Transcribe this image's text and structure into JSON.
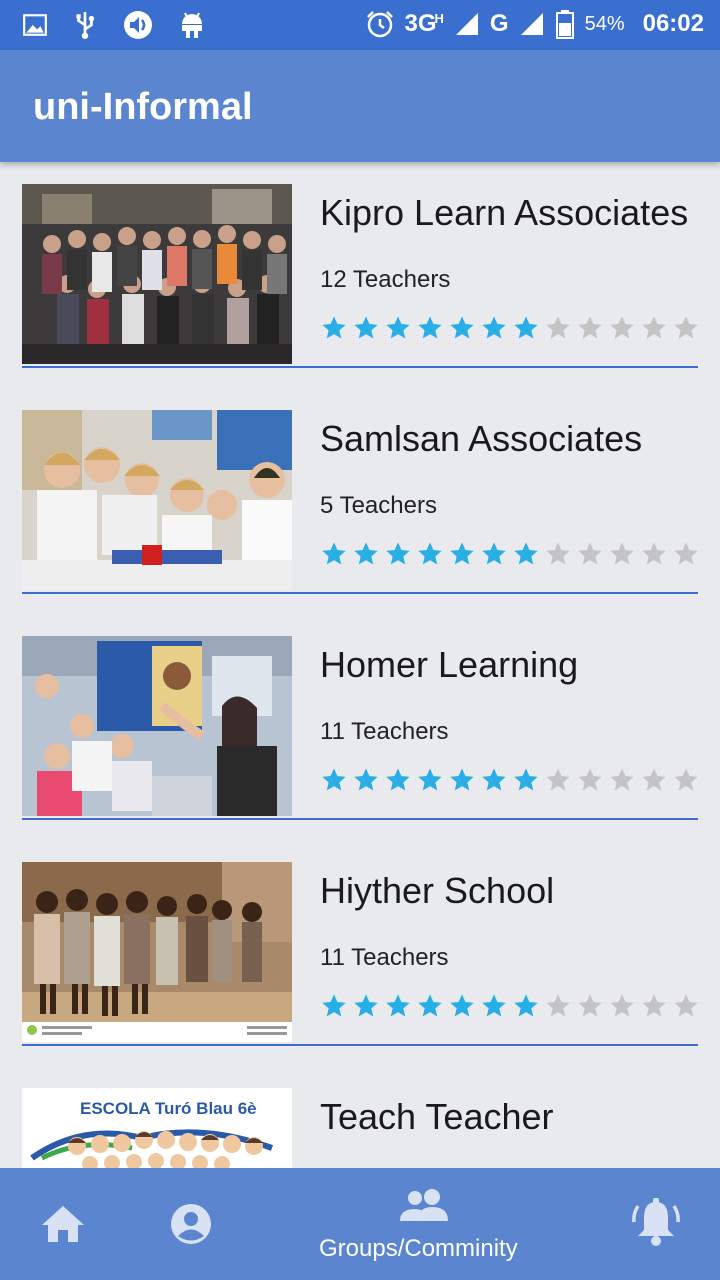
{
  "status_bar": {
    "network_3g": "3G",
    "network_h": "H",
    "network_g": "G",
    "battery": "54%",
    "time": "06:02"
  },
  "app_bar": {
    "title": "uni-Informal"
  },
  "groups": [
    {
      "name": "Kipro Learn Associates",
      "teachers": "12 Teachers",
      "rating": 7,
      "max_rating": 12
    },
    {
      "name": "Samlsan Associates",
      "teachers": "5 Teachers",
      "rating": 7,
      "max_rating": 12
    },
    {
      "name": "Homer Learning",
      "teachers": "11 Teachers",
      "rating": 7,
      "max_rating": 12
    },
    {
      "name": "Hiyther School",
      "teachers": "11 Teachers",
      "rating": 7,
      "max_rating": 12
    },
    {
      "name": "Teach Teacher",
      "teachers": "",
      "rating": 0,
      "max_rating": 12,
      "thumb_text": "ESCOLA Turó Blau 6è"
    }
  ],
  "bottom_nav": {
    "home_icon": "home-icon",
    "profile_icon": "account-icon",
    "groups_label": "Groups/Comminity",
    "notifications_icon": "bell-icon"
  },
  "colors": {
    "status_bar": "#3a6fd0",
    "app_bar": "#5b86cf",
    "star_filled": "#29aee6",
    "star_empty": "#c4c4c4",
    "divider": "#3a6fd0"
  }
}
